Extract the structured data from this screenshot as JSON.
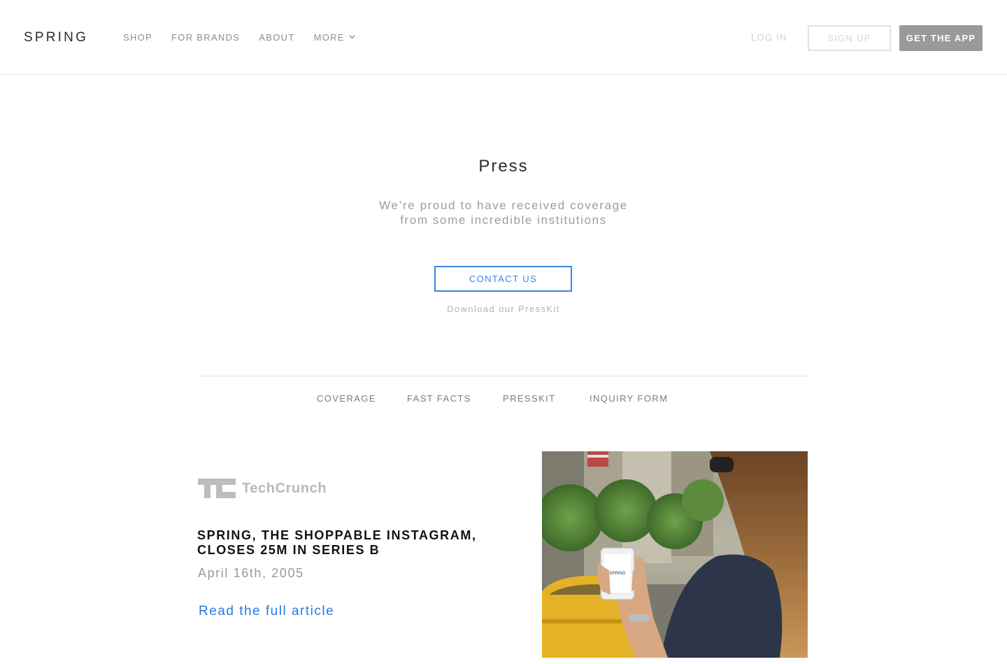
{
  "header": {
    "logo": "SPRING",
    "nav": [
      {
        "label": "SHOP"
      },
      {
        "label": "FOR BRANDS"
      },
      {
        "label": "ABOUT"
      },
      {
        "label": "MORE"
      }
    ],
    "login_label": "LOG IN",
    "signup_label": "SIGN UP",
    "get_app_label": "GET THE APP"
  },
  "hero": {
    "title": "Press",
    "subtitle_line1": "We’re proud to have received coverage",
    "subtitle_line2": "from some incredible institutions",
    "contact_label": "CONTACT US",
    "presskit_link": "Download our PressKit"
  },
  "subnav": [
    {
      "label": "COVERAGE"
    },
    {
      "label": "FAST FACTS"
    },
    {
      "label": "PRESSKIT"
    },
    {
      "label": "INQUIRY FORM"
    }
  ],
  "article": {
    "publication": "TechCrunch",
    "title_line1": "SPRING, THE SHOPPABLE INSTAGRAM,",
    "title_line2": "CLOSES 25M IN SERIES B",
    "date": "April 16th, 2005",
    "link_label": "Read the full article",
    "photo_phone_text": "SPRING"
  },
  "colors": {
    "accent": "#3a86e0",
    "link": "#2a7ae2",
    "nav_text": "#8c8c8c",
    "app_button": "#9a9a9a"
  }
}
